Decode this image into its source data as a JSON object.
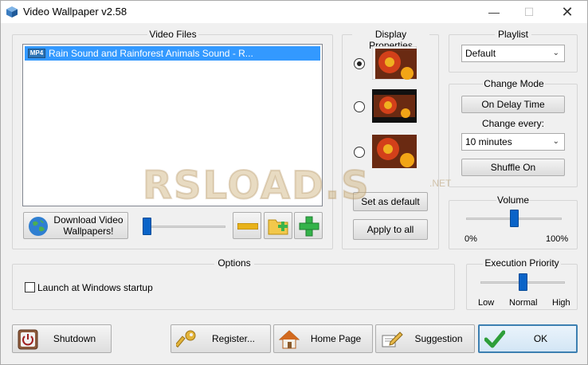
{
  "window": {
    "title": "Video Wallpaper  v2.58"
  },
  "video_files": {
    "label": "Video Files",
    "items": [
      {
        "badge": "MP4",
        "name": "Rain Sound and Rainforest Animals Sound - R..."
      }
    ],
    "download_button": "Download Video\nWallpapers!",
    "slider_value": 0
  },
  "display": {
    "label": "Display Properties",
    "selected_index": 0,
    "set_default": "Set as default",
    "apply_all": "Apply to all"
  },
  "playlist": {
    "label": "Playlist",
    "value": "Default"
  },
  "change_mode": {
    "label": "Change Mode",
    "on_delay": "On Delay Time",
    "change_every_label": "Change every:",
    "change_every_value": "10 minutes",
    "shuffle": "Shuffle On"
  },
  "volume": {
    "label": "Volume",
    "min": "0%",
    "max": "100%",
    "level_percent": 50
  },
  "options": {
    "label": "Options",
    "launch_startup": "Launch at Windows startup",
    "launch_checked": false
  },
  "priority": {
    "label": "Execution Priority",
    "low": "Low",
    "normal": "Normal",
    "high": "High",
    "value": "Normal"
  },
  "buttons": {
    "shutdown": "Shutdown",
    "register": "Register...",
    "home": "Home Page",
    "suggestion": "Suggestion",
    "ok": "OK"
  },
  "watermark": {
    "text": "RSLOAD.S",
    "sub": ".NET"
  },
  "colors": {
    "selection": "#3399ff",
    "slider": "#0a64c8"
  }
}
